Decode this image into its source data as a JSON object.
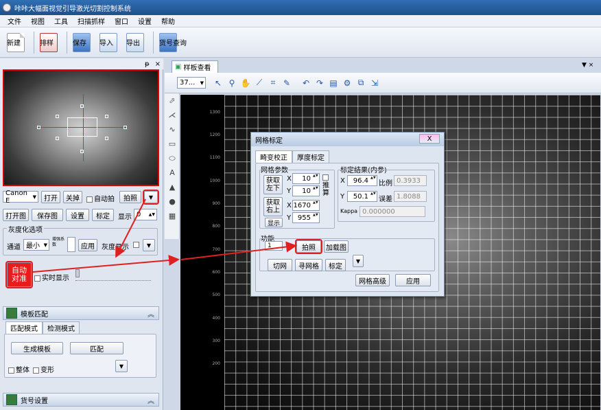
{
  "window": {
    "title": "咔咔大幅面视觉引导激光切割控制系统"
  },
  "menu": [
    "文件",
    "视图",
    "工具",
    "扫描抓样",
    "窗口",
    "设置",
    "帮助"
  ],
  "toolbar": [
    {
      "label": "新建",
      "icon": "new-doc-icon"
    },
    {
      "label": "排样",
      "icon": "layout-icon"
    },
    {
      "label": "保存",
      "icon": "save-icon"
    },
    {
      "label": "导入",
      "icon": "import-icon"
    },
    {
      "label": "导出",
      "icon": "export-icon"
    },
    {
      "label": "货号查询",
      "icon": "query-icon"
    }
  ],
  "panel_header": {
    "pin": "ᵽ",
    "close": "×"
  },
  "camera": {
    "model": "Canon E",
    "open": "打开",
    "close": "关掉",
    "auto_capture": "自动拍",
    "capture": "拍照",
    "open_image": "打开图",
    "save_image": "保存图",
    "settings": "设置",
    "calibrate": "标定",
    "display": "显示",
    "display_value": "0"
  },
  "grayscale": {
    "group": "灰度化选项",
    "channel_label": "通道",
    "channel_value": "最小",
    "enhance_label": "增强系数",
    "apply": "应用",
    "gray_display": "灰度显示"
  },
  "auto_match": {
    "label": "自动对准",
    "realtime": "实时显示"
  },
  "template": {
    "section": "模板匹配",
    "tabs": [
      "匹配模式",
      "检测模式"
    ],
    "generate": "生成模板",
    "match": "匹配",
    "whole": "整体",
    "deform": "变形"
  },
  "product": {
    "section": "货号设置"
  },
  "document": {
    "tab": "样板查看",
    "zoom": "37..."
  },
  "ruler_labels": [
    "1300",
    "1200",
    "1100",
    "1000",
    "900",
    "800",
    "700",
    "600",
    "500",
    "400",
    "300",
    "200"
  ],
  "dialog": {
    "title": "网格标定",
    "close": "X",
    "tabs": [
      "畸变校正",
      "厚度标定"
    ],
    "grid_params": "网格参数",
    "calib_result": "标定结果(内参)",
    "get_left_bottom": "获取左下",
    "get_right_top": "获取右上",
    "show": "显示",
    "x1_label": "X",
    "x1_value": "10",
    "y1_label": "Y",
    "y1_value": "10",
    "x2_label": "X",
    "x2_value": "1670",
    "y2_label": "Y",
    "y2_value": "955",
    "infer": "推算",
    "rx_label": "X",
    "rx_value": "96.4",
    "ratio_label": "比例",
    "ratio_value": "0.3933",
    "ry_label": "Y",
    "ry_value": "50.1",
    "error_label": "误差",
    "error_value": "1.8088",
    "kappa_label": "Kappa",
    "kappa_value": "0.000000",
    "function": "功能",
    "func_num": "1",
    "capture": "拍照",
    "load_image": "加载图",
    "cut_grid": "切网",
    "find_grid": "寻网格",
    "calibrate": "标定",
    "grid_advanced": "网格高级",
    "apply": "应用"
  }
}
